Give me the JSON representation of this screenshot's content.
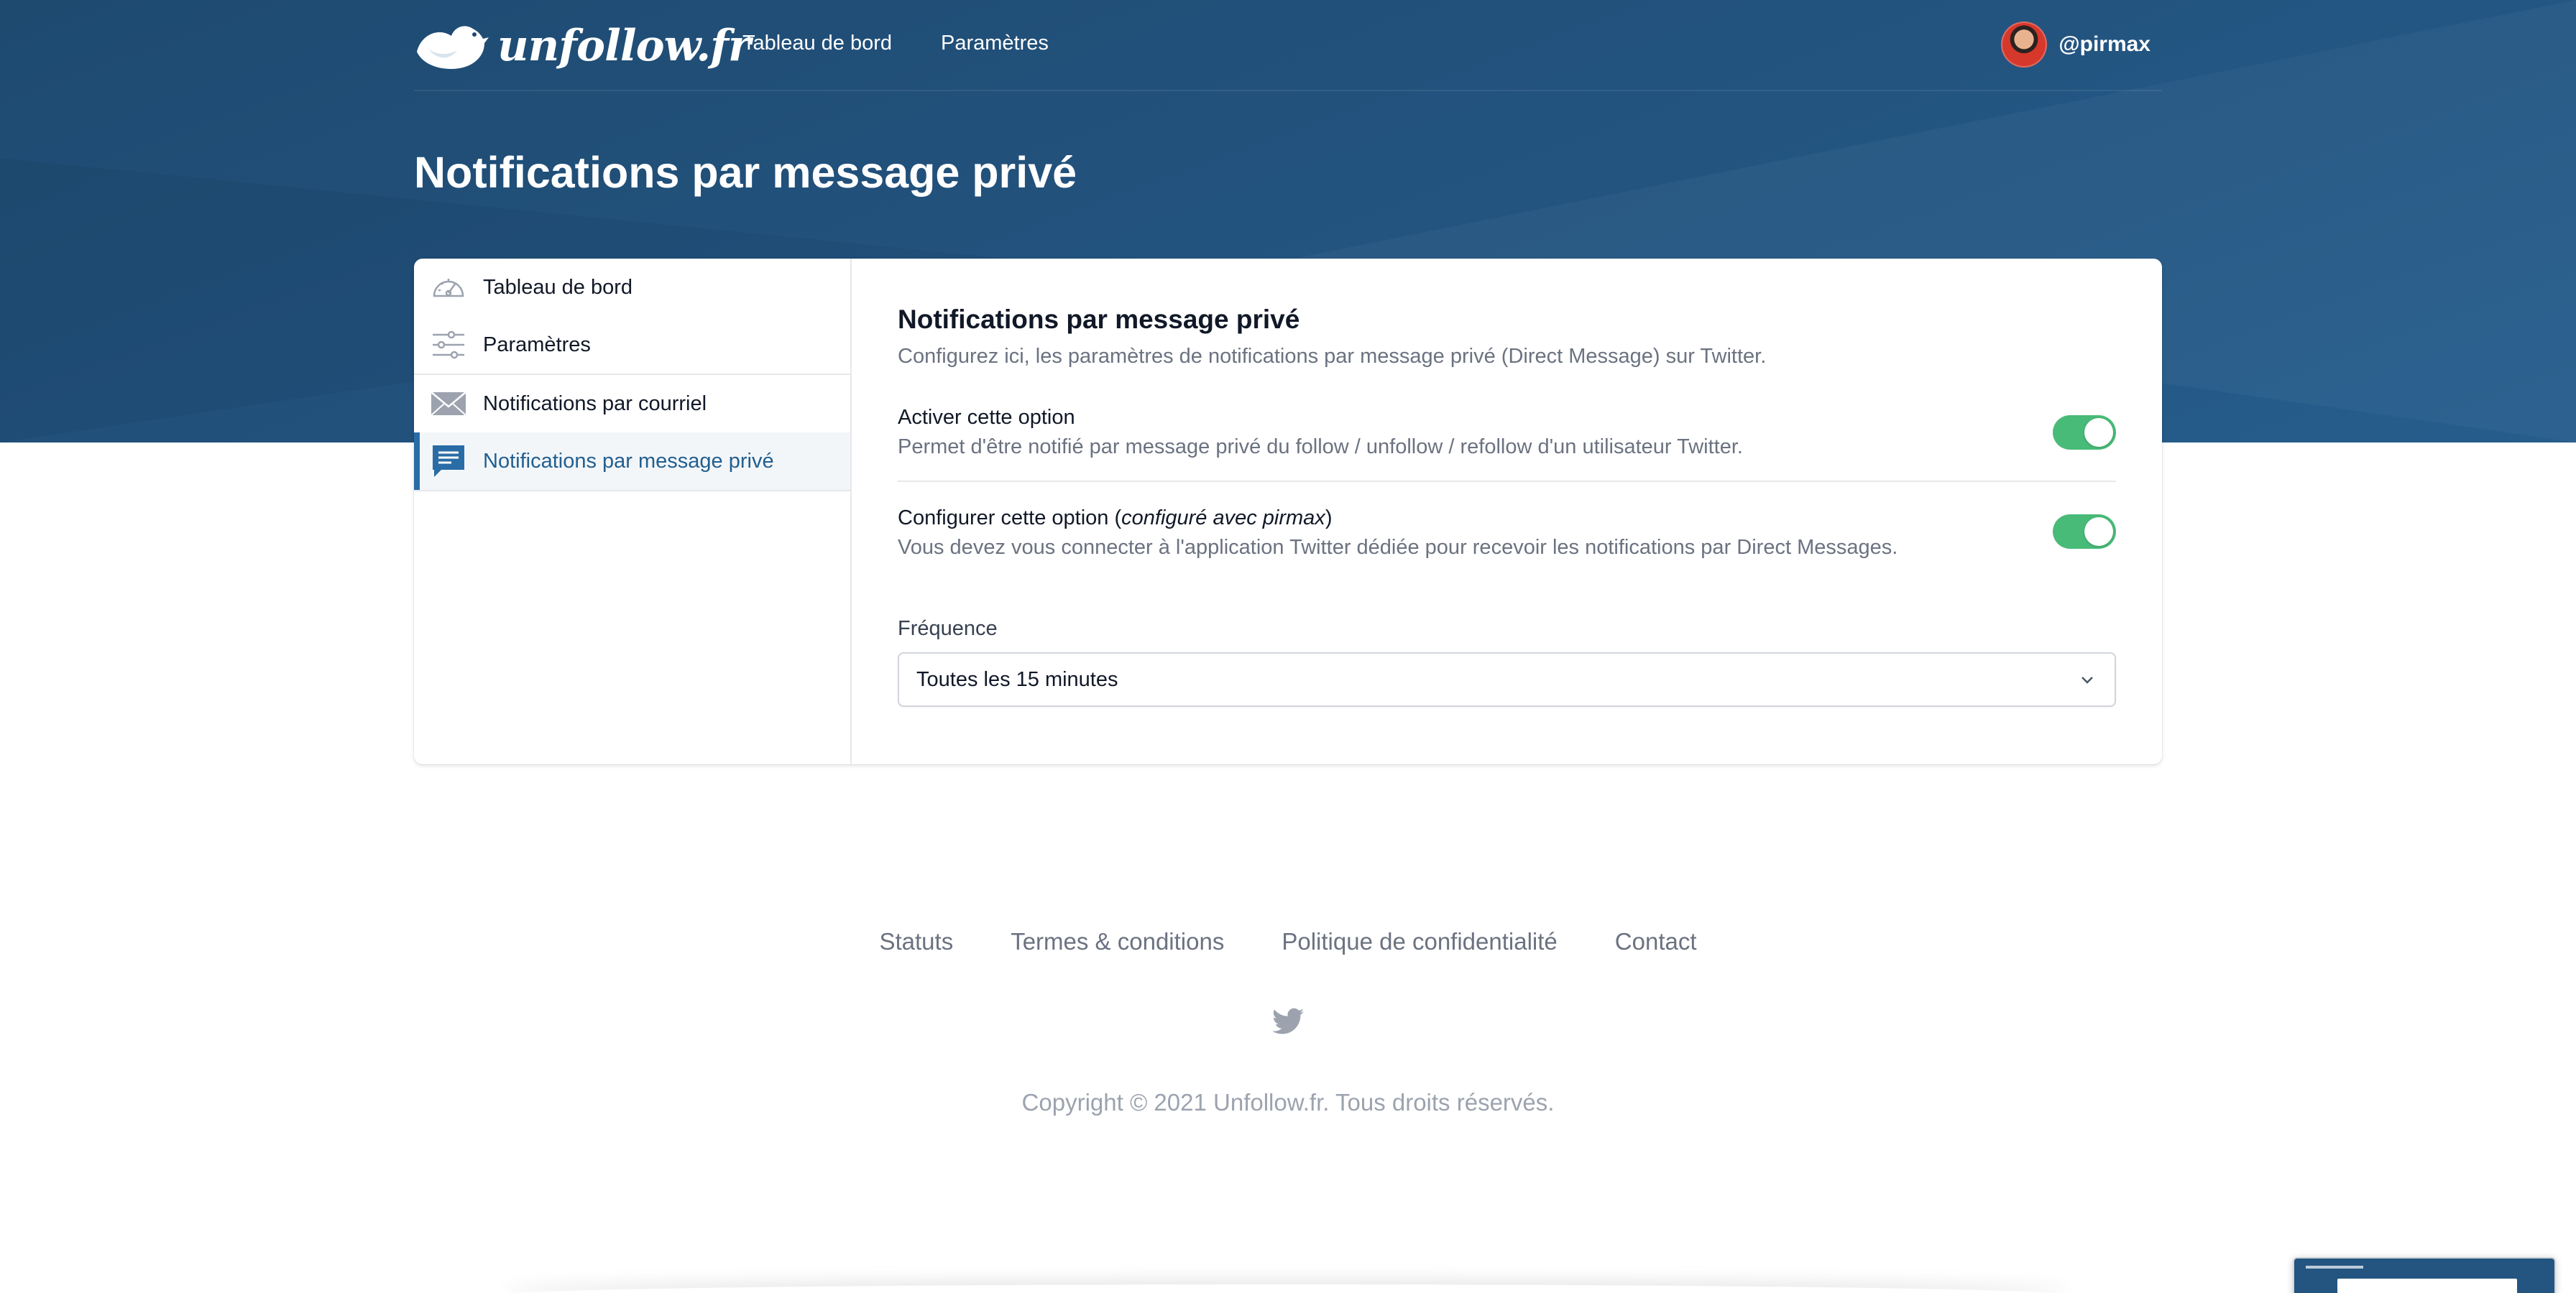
{
  "app": {
    "logo_text": "unfollow.fr"
  },
  "nav": {
    "items": [
      {
        "label": "Tableau de bord"
      },
      {
        "label": "Paramètres"
      }
    ],
    "username": "@pirmax"
  },
  "page": {
    "title": "Notifications par message privé"
  },
  "sidebar": {
    "items": [
      {
        "label": "Tableau de bord",
        "icon": "dashboard-gauge-icon"
      },
      {
        "label": "Paramètres",
        "icon": "sliders-icon"
      },
      {
        "label": "Notifications par courriel",
        "icon": "envelope-icon"
      },
      {
        "label": "Notifications par message privé",
        "icon": "chat-message-icon",
        "active": true
      }
    ]
  },
  "section": {
    "title": "Notifications par message privé",
    "description": "Configurez ici, les paramètres de notifications par message privé (Direct Message) sur Twitter."
  },
  "options": [
    {
      "title": "Activer cette option",
      "description": "Permet d'être notifié par message privé du follow / unfollow / refollow d'un utilisateur Twitter.",
      "enabled": true
    },
    {
      "title_prefix": "Configurer cette option (",
      "title_em": "configuré avec pirmax",
      "title_suffix": ")",
      "description": "Vous devez vous connecter à l'application Twitter dédiée pour recevoir les notifications par Direct Messages.",
      "enabled": true
    }
  ],
  "frequency": {
    "label": "Fréquence",
    "selected": "Toutes les 15 minutes"
  },
  "footer": {
    "links": [
      "Statuts",
      "Termes & conditions",
      "Politique de confidentialité",
      "Contact"
    ],
    "copyright": "Copyright © 2021 Unfollow.fr. Tous droits réservés."
  },
  "colors": {
    "hero": "#22527d",
    "accent": "#2a6ca6",
    "toggle_on": "#48bb78"
  }
}
